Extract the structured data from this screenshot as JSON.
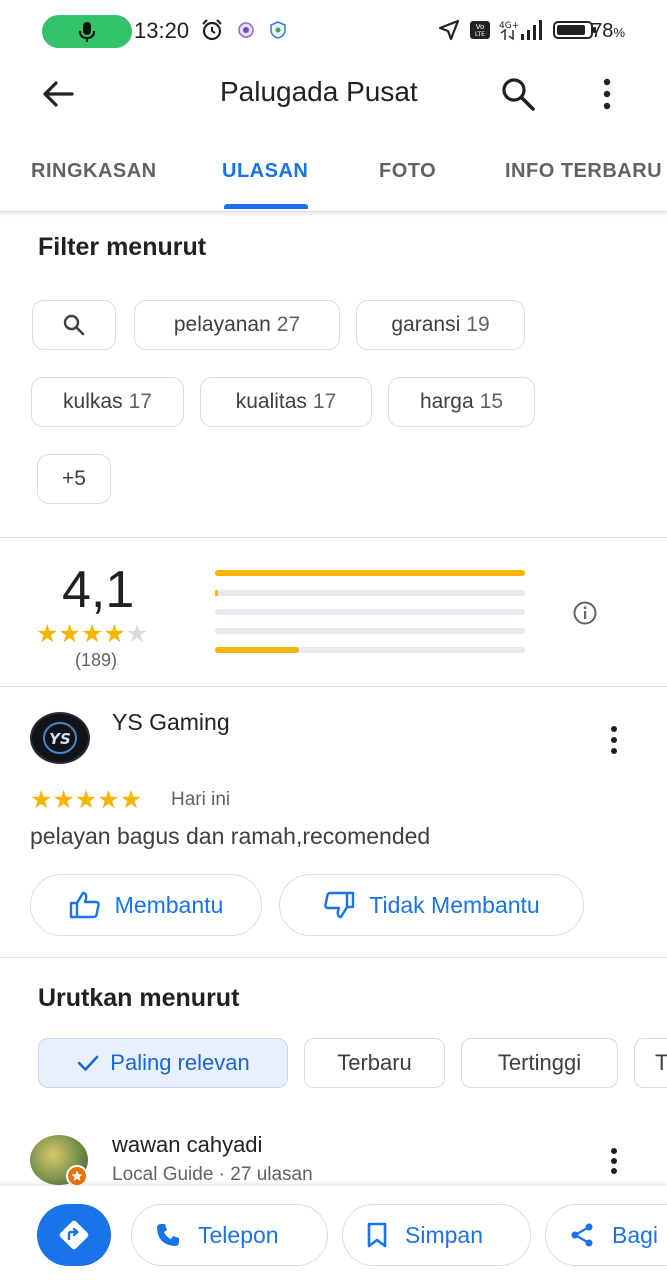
{
  "status_bar": {
    "time": "13:20",
    "battery_percent": "78",
    "percent_sign": "%",
    "network": "4G+",
    "volte": "Vo LTE"
  },
  "app_bar": {
    "title": "Palugada Pusat"
  },
  "tabs": [
    {
      "label": "RINGKASAN",
      "active": false
    },
    {
      "label": "ULASAN",
      "active": true
    },
    {
      "label": "FOTO",
      "active": false
    },
    {
      "label": "INFO TERBARU",
      "active": false
    }
  ],
  "filter": {
    "title": "Filter menurut",
    "topics": [
      {
        "label": "pelayanan",
        "count": "27"
      },
      {
        "label": "garansi",
        "count": "19"
      },
      {
        "label": "kulkas",
        "count": "17"
      },
      {
        "label": "kualitas",
        "count": "17"
      },
      {
        "label": "harga",
        "count": "15"
      }
    ],
    "more_label": "+5"
  },
  "rating_summary": {
    "average": "4,1",
    "count": "(189)",
    "stars_filled": 4.1,
    "distribution_fraction": [
      1.0,
      0.01,
      0.0,
      0.0,
      0.27
    ]
  },
  "review": {
    "author": "YS Gaming",
    "date": "Hari ini",
    "stars": 5,
    "text": "pelayan bagus dan ramah,recomended",
    "helpful_label": "Membantu",
    "not_helpful_label": "Tidak Membantu"
  },
  "sort": {
    "title": "Urutkan menurut",
    "options": [
      {
        "label": "Paling relevan",
        "selected": true
      },
      {
        "label": "Terbaru",
        "selected": false
      },
      {
        "label": "Tertinggi",
        "selected": false
      },
      {
        "label": "T",
        "selected": false
      }
    ]
  },
  "review2": {
    "author": "wawan cahyadi",
    "meta": "Local Guide · 27 ulasan"
  },
  "bottom_actions": {
    "call_label": "Telepon",
    "save_label": "Simpan",
    "share_label": "Bagi"
  },
  "colors": {
    "accent": "#1a73e8",
    "star": "#f4b400",
    "mic_pill": "#34c36b"
  }
}
